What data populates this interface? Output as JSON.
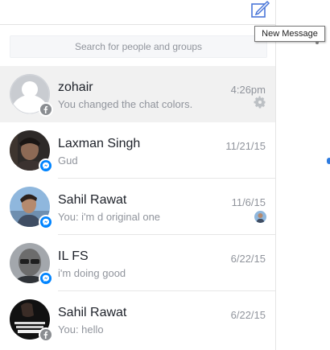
{
  "header": {
    "compose_icon": "compose-icon",
    "tooltip": "New Message"
  },
  "search": {
    "placeholder": "Search for people and groups"
  },
  "threads": [
    {
      "name": "zohair",
      "snippet": "You changed the chat colors.",
      "time": "4:26pm",
      "badge": "facebook",
      "selected": true
    },
    {
      "name": "Laxman Singh",
      "snippet": "Gud",
      "time": "11/21/15",
      "badge": "messenger"
    },
    {
      "name": "Sahil Rawat",
      "snippet": "You: i'm d original one",
      "time": "11/6/15",
      "badge": "messenger"
    },
    {
      "name": "IL FS",
      "snippet": "i'm doing good",
      "time": "6/22/15",
      "badge": "messenger"
    },
    {
      "name": "Sahil Rawat",
      "snippet": "You: hello",
      "time": "6/22/15",
      "badge": "facebook"
    }
  ],
  "colors": {
    "accent": "#0084ff",
    "selected_row": "#f1f1f1",
    "muted_text": "#90949c"
  }
}
